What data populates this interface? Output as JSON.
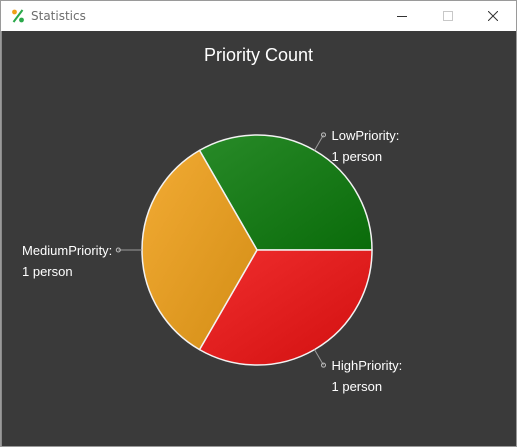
{
  "window": {
    "title": "Statistics",
    "app_icon": "percent-icon",
    "controls": [
      "minimize-icon",
      "maximize-icon",
      "close-icon"
    ]
  },
  "chart_data": {
    "type": "pie",
    "title": "Priority Count",
    "series": [
      {
        "name": "LowPriority",
        "value": 1,
        "value_label": "1 person",
        "color": "#0b7a0b"
      },
      {
        "name": "HighPriority",
        "value": 1,
        "value_label": "1 person",
        "color": "#ee1111"
      },
      {
        "name": "MediumPriority",
        "value": 1,
        "value_label": "1 person",
        "color": "#f0a018"
      }
    ],
    "background": "#3a3a3a"
  }
}
